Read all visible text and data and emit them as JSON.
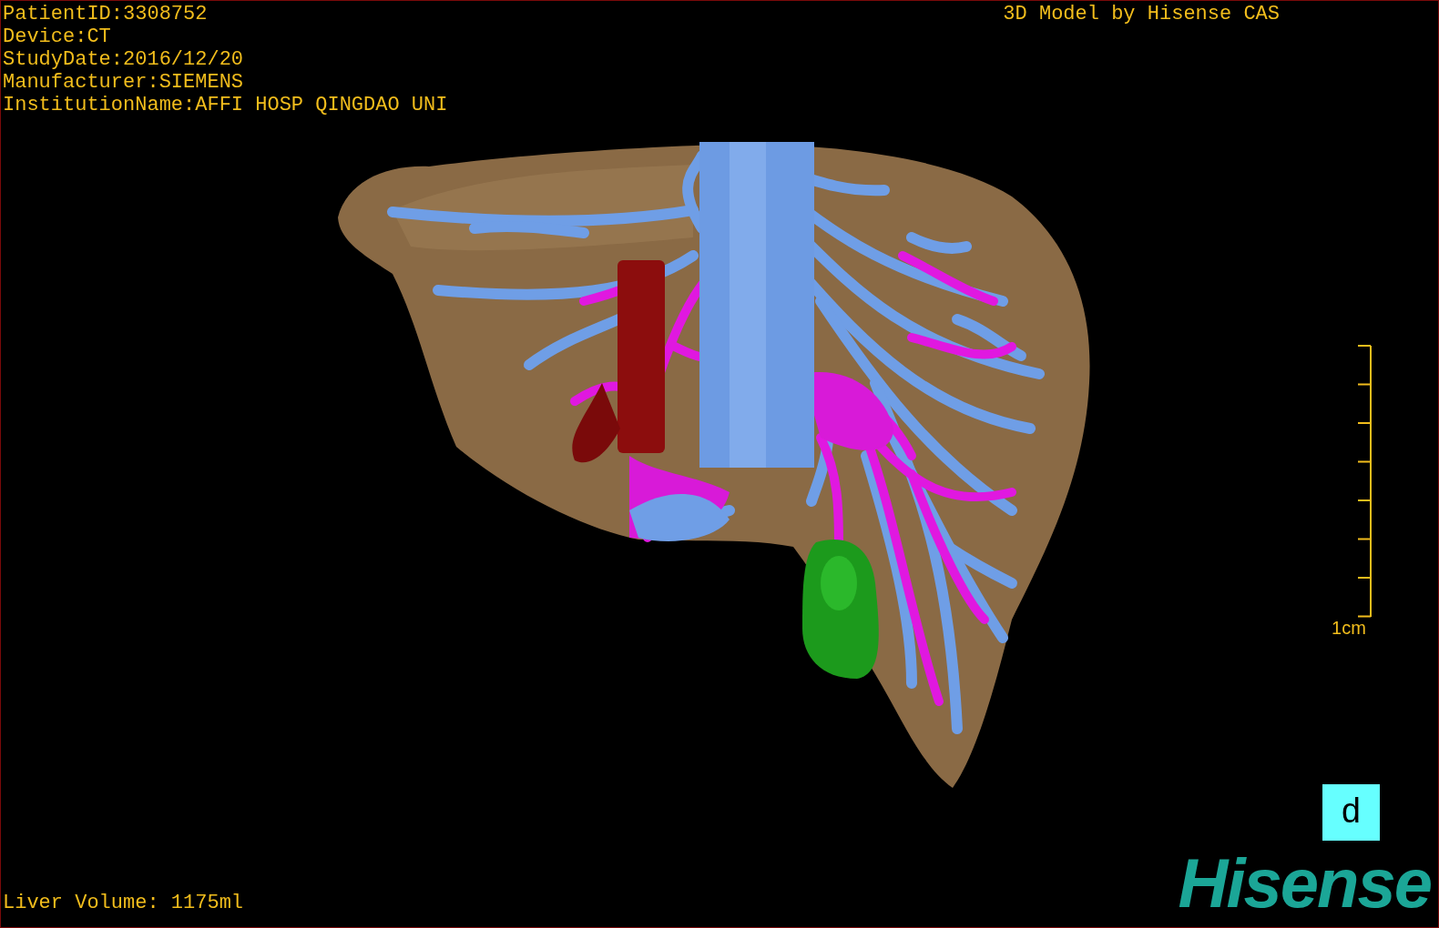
{
  "info_lines": [
    "PatientID:3308752",
    "Device:CT",
    "StudyDate:2016/12/20",
    "Manufacturer:SIEMENS",
    "InstitutionName:AFFI HOSP QINGDAO UNI"
  ],
  "title": "3D Model by Hisense CAS",
  "scale": {
    "label": "1cm"
  },
  "liver_volume": "Liver Volume: 1175ml",
  "view_button": {
    "label": "d"
  },
  "logo": {
    "text": "Hisense"
  }
}
